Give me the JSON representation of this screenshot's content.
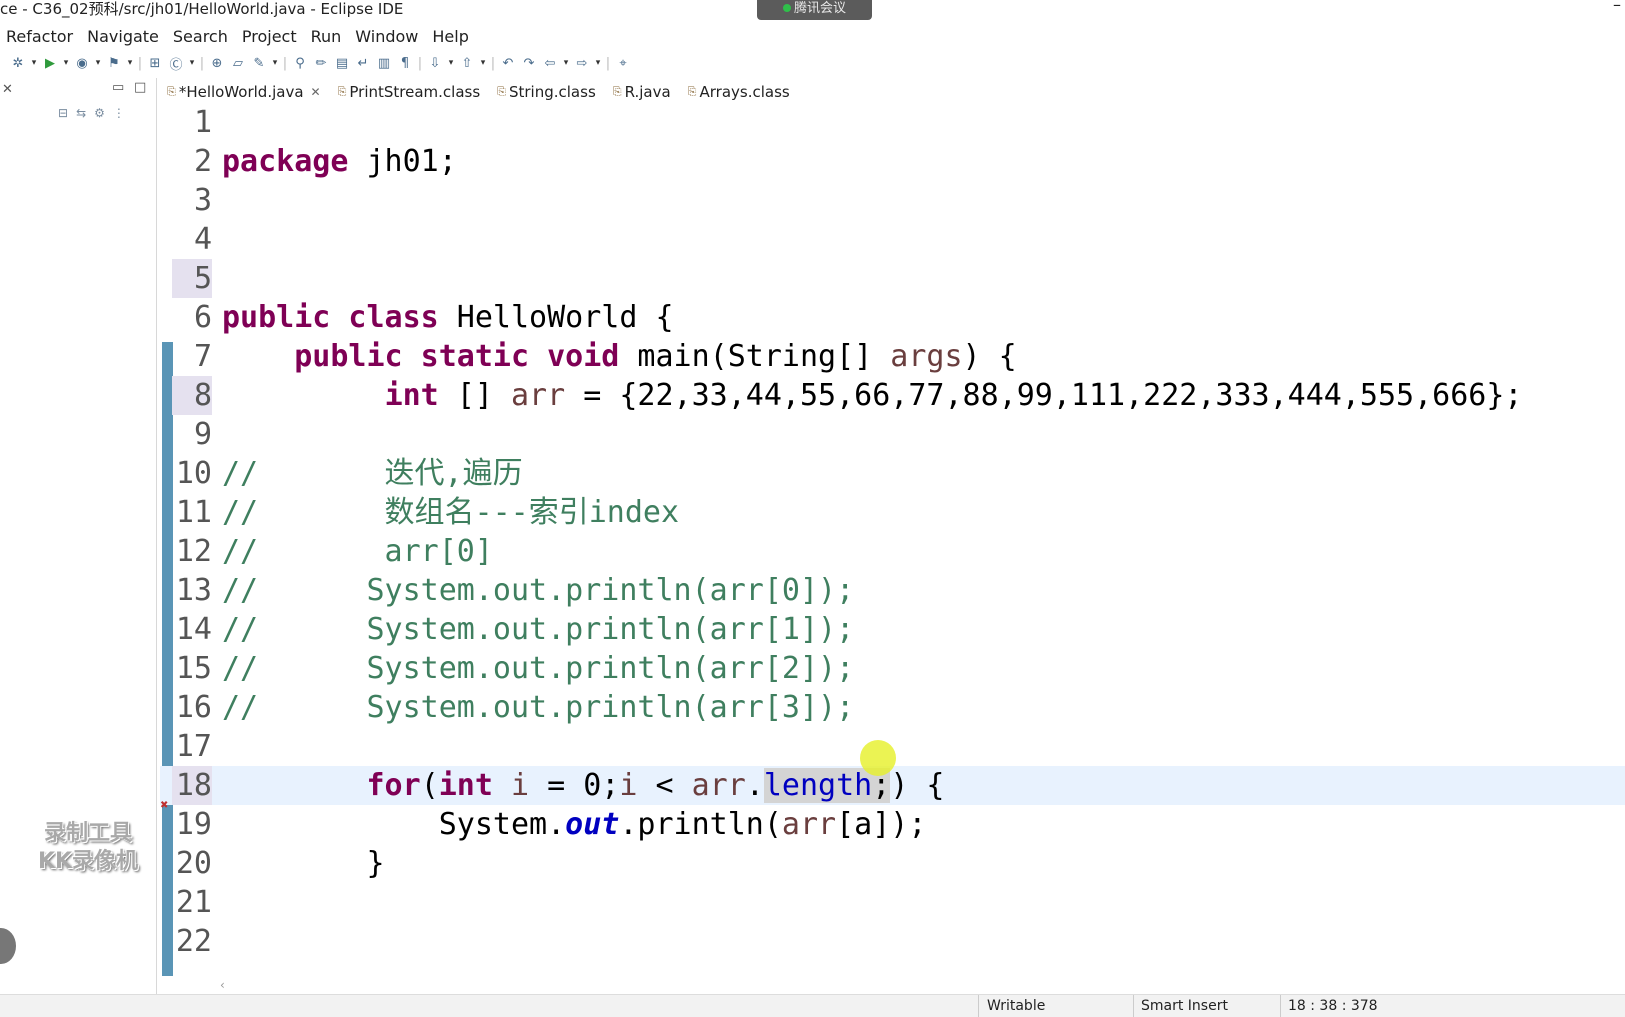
{
  "window": {
    "title": "ce - C36_02预科/src/jh01/HelloWorld.java - Eclipse IDE",
    "meeting_label": "腾讯会议",
    "minimize_glyph": "–"
  },
  "menu": [
    "Refactor",
    "Navigate",
    "Search",
    "Project",
    "Run",
    "Window",
    "Help"
  ],
  "toolbar_icons": [
    "debug-icon",
    "dropdown",
    "run-icon",
    "dropdown",
    "coverage-icon",
    "dropdown",
    "external-tools-icon",
    "dropdown",
    "sep",
    "new-package-icon",
    "new-class-icon",
    "dropdown",
    "sep",
    "open-type-icon",
    "open-folder-icon",
    "open-task-icon",
    "dropdown",
    "sep",
    "search-icon",
    "mark-occurrences-icon",
    "toggle-block-icon",
    "word-wrap-icon",
    "show-whitespace-icon",
    "pilcrow-icon",
    "sep",
    "next-annotation-icon",
    "dropdown",
    "prev-annotation-icon",
    "dropdown",
    "sep",
    "last-edit-icon",
    "forward-edit-icon",
    "back-icon",
    "dropdown",
    "forward-icon",
    "dropdown",
    "sep",
    "pin-editor-icon"
  ],
  "left_panel": {
    "close_glyph": "✕",
    "watermark": [
      "录制工具",
      "KK录像机"
    ]
  },
  "tabs": [
    {
      "label": "*HelloWorld.java",
      "active": true,
      "closable": true
    },
    {
      "label": "PrintStream.class",
      "active": false,
      "closable": false
    },
    {
      "label": "String.class",
      "active": false,
      "closable": false
    },
    {
      "label": "R.java",
      "active": false,
      "closable": false
    },
    {
      "label": "Arrays.class",
      "active": false,
      "closable": false
    }
  ],
  "code_lines": [
    {
      "n": "1",
      "html": ""
    },
    {
      "n": "2",
      "html": "<span class=\"kw\">package</span> jh01;"
    },
    {
      "n": "3",
      "html": ""
    },
    {
      "n": "4",
      "html": ""
    },
    {
      "n": "5",
      "html": ""
    },
    {
      "n": "6",
      "html": "<span class=\"kw\">public class</span> HelloWorld {"
    },
    {
      "n": "7",
      "html": "    <span class=\"kw\">public static void</span> main(String[] <span class=\"var\">args</span>) {"
    },
    {
      "n": "8",
      "html": "         <span class=\"kw\">int</span> [] <span class=\"var\">arr</span> = {22,33,44,55,66,77,88,99,111,222,333,444,555,666};"
    },
    {
      "n": "9",
      "html": ""
    },
    {
      "n": "10",
      "html": "<span class=\"cm\">//       迭代,遍历</span>"
    },
    {
      "n": "11",
      "html": "<span class=\"cm\">//       数组名---索引index</span>"
    },
    {
      "n": "12",
      "html": "<span class=\"cm\">//       arr[0]</span>"
    },
    {
      "n": "13",
      "html": "<span class=\"cm\">//      System.out.println(arr[0]);</span>"
    },
    {
      "n": "14",
      "html": "<span class=\"cm\">//      System.out.println(arr[1]);</span>"
    },
    {
      "n": "15",
      "html": "<span class=\"cm\">//      System.out.println(arr[2]);</span>"
    },
    {
      "n": "16",
      "html": "<span class=\"cm\">//      System.out.println(arr[3]);</span>"
    },
    {
      "n": "17",
      "html": ""
    },
    {
      "n": "18",
      "html": "        <span class=\"kw\">for</span>(<span class=\"kw\">int</span> <span class=\"var\">i</span> = 0;<span class=\"var\">i</span> &lt; <span class=\"var\">arr</span>.<span class=\"sel\"><span style=\"color:#0000c0\">length</span>;</span>) {"
    },
    {
      "n": "19",
      "html": "            System.<span class=\"fld\">out</span>.println(<span class=\"var\">arr</span>[a]);"
    },
    {
      "n": "20",
      "html": "        }"
    },
    {
      "n": "21",
      "html": ""
    },
    {
      "n": "22",
      "html": ""
    }
  ],
  "status": {
    "writable": "Writable",
    "insert_mode": "Smart Insert",
    "position": "18 : 38 : 378"
  },
  "colors": {
    "keyword": "#7f0055",
    "comment": "#3f7f5f",
    "field": "#0000c0",
    "current_line": "#e8f2fe",
    "gutter_bar": "#5a95b6"
  }
}
